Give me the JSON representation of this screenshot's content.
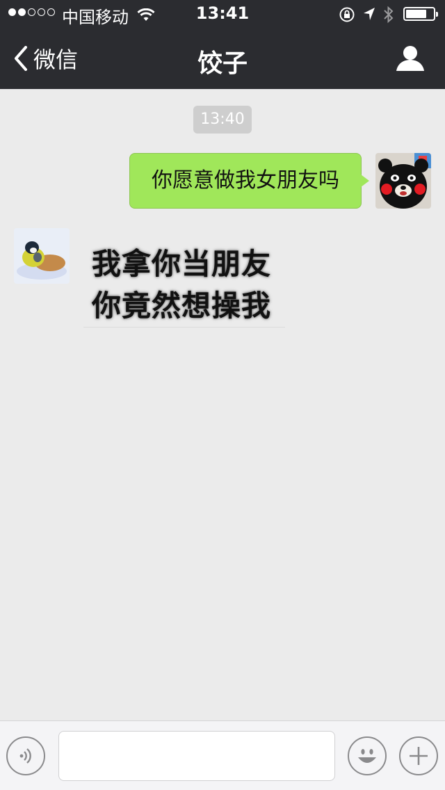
{
  "status_bar": {
    "carrier": "中国移动",
    "time": "13:41",
    "signal_bars_filled": 2,
    "signal_bars_total": 5,
    "battery_level": 0.75
  },
  "nav": {
    "back_label": "微信",
    "title": "饺子",
    "profile_icon": "person-icon"
  },
  "chat": {
    "timestamp": "13:40",
    "messages": [
      {
        "side": "right",
        "type": "text",
        "text": "你愿意做我女朋友吗",
        "avatar": "kumamon-bear-avatar"
      },
      {
        "side": "left",
        "type": "sticker",
        "lines": [
          "我拿你当朋友",
          "你竟然想操我"
        ],
        "avatar": "bird-avatar"
      }
    ]
  },
  "input_bar": {
    "voice_icon": "voice-icon",
    "emoji_icon": "emoji-icon",
    "plus_icon": "plus-icon",
    "value": "",
    "placeholder": ""
  },
  "colors": {
    "header_bg": "#2b2c30",
    "chat_bg": "#ebebeb",
    "bubble_green": "#a0e75a",
    "timestamp_bg": "#cecece"
  }
}
